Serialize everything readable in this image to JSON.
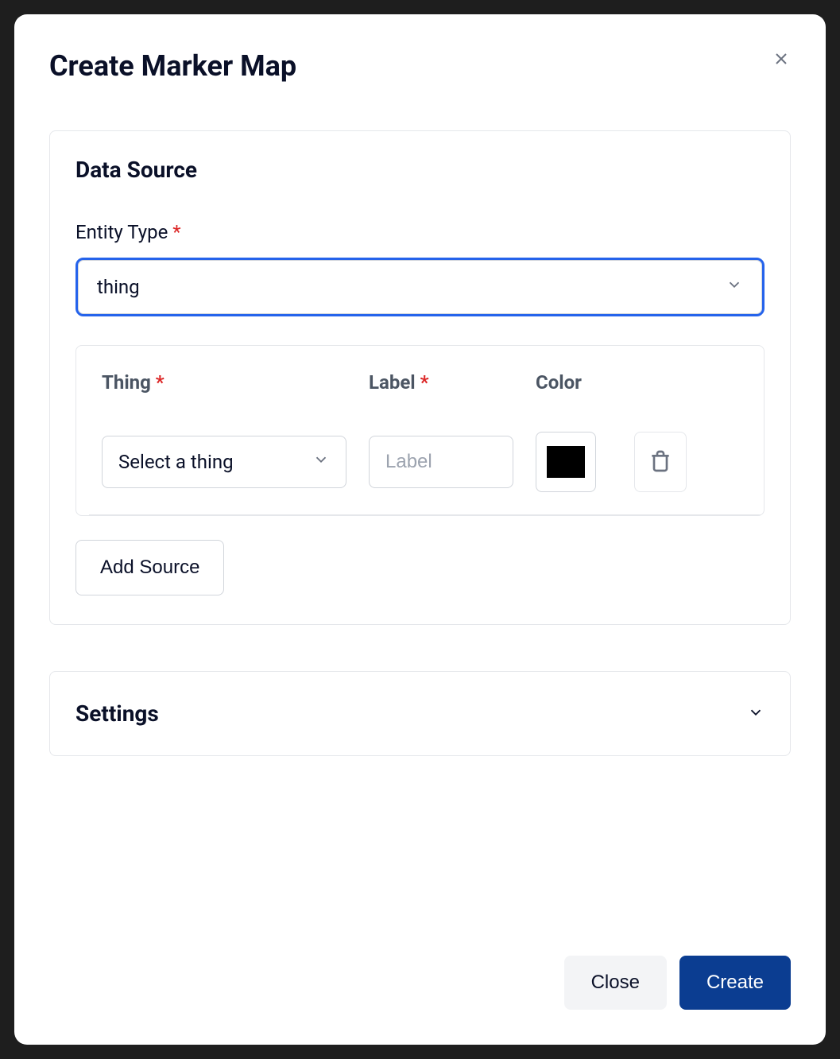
{
  "modal": {
    "title": "Create Marker Map"
  },
  "dataSource": {
    "heading": "Data Source",
    "entityType": {
      "label": "Entity Type",
      "value": "thing"
    },
    "columns": {
      "thing": "Thing",
      "label": "Label",
      "color": "Color"
    },
    "row": {
      "thingPlaceholder": "Select a thing",
      "labelPlaceholder": "Label",
      "colorValue": "#000000"
    },
    "addSourceLabel": "Add Source"
  },
  "settings": {
    "heading": "Settings"
  },
  "footer": {
    "closeLabel": "Close",
    "createLabel": "Create"
  }
}
